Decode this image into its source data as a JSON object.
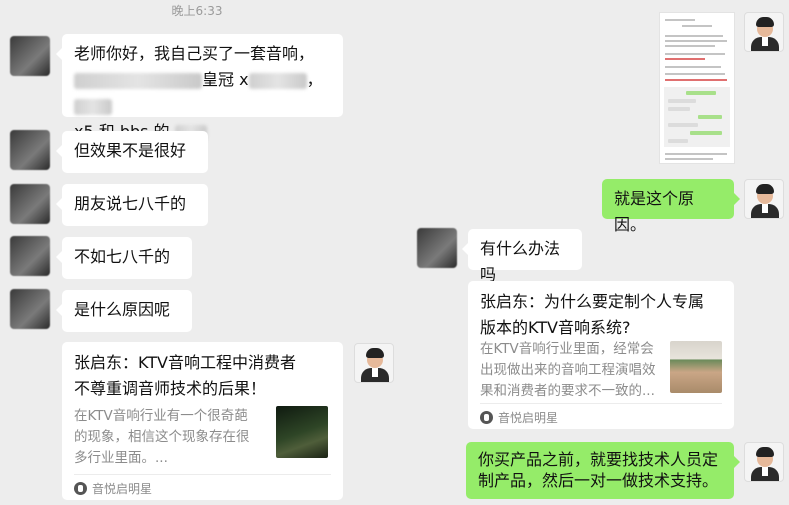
{
  "status_time": "晚上6:33",
  "left_messages": [
    "老师你好，我自己买了一套音响，",
    "皇冠 x",
    "x5 和 bbs 的",
    "但效果不是很好",
    "朋友说七八千的",
    "不如七八千的",
    "是什么原因呢"
  ],
  "left_card": {
    "title_line1": "张启东：KTV音响工程中消费者",
    "title_line2": "不尊重调音师技术的后果！",
    "desc": [
      "在KTV音响行业有一个很奇葩",
      "的现象，相信这个现象存在很",
      "多行业里面。..."
    ],
    "source": "音悦启明星"
  },
  "right_messages": {
    "reply1": "就是这个原因。",
    "question": "有什么办法吗",
    "reply2_line1": "你买产品之前，就要找技术人员定",
    "reply2_line2": "制产品，然后一对一做技术支持。"
  },
  "right_card": {
    "title_line1": "张启东：为什么要定制个人专属",
    "title_line2": "版本的KTV音响系统?",
    "desc": [
      "在KTV音响行业里面，经常会",
      "出现做出来的音响工程演唱效",
      "果和消费者的要求不一致的..."
    ],
    "source": "音悦启明星"
  },
  "colors": {
    "background": "#ededed",
    "outgoing_bubble": "#95ec69",
    "incoming_bubble": "#ffffff"
  }
}
